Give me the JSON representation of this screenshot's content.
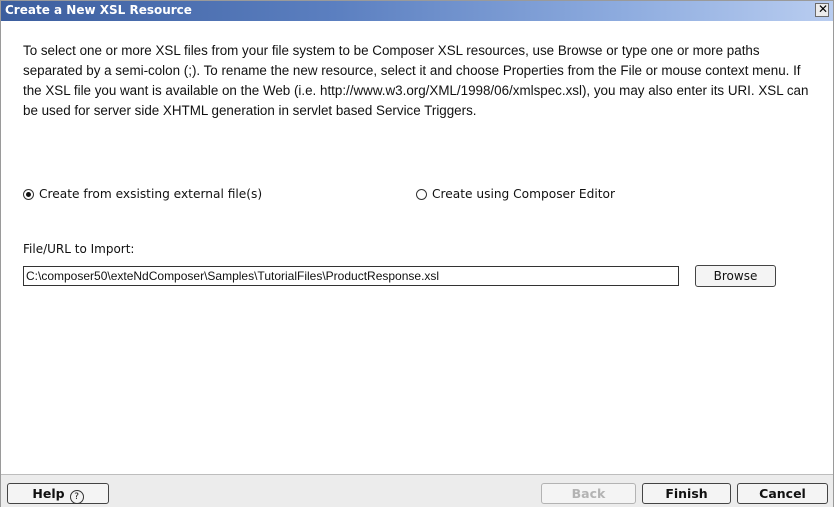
{
  "dialog": {
    "title": "Create a New XSL Resource",
    "close_symbol": "✕"
  },
  "description": "To select one or more XSL files from your file system to be Composer XSL  resources, use Browse or type one or more paths separated by a semi-colon (;). To rename the new resource, select it and choose Properties from the File or mouse context menu. If the XSL file you want is available on the Web (i.e. http://www.w3.org/XML/1998/06/xmlspec.xsl), you may also enter its URI. XSL can be used for server side XHTML generation in servlet based Service Triggers.",
  "options": {
    "existing_file_label": "Create from exsisting external file(s)",
    "existing_file_selected": true,
    "editor_label": "Create using Composer Editor",
    "editor_selected": false
  },
  "import": {
    "label": "File/URL to Import:",
    "value": "C:\\composer50\\exteNdComposer\\Samples\\TutorialFiles\\ProductResponse.xsl",
    "browse_label": "Browse"
  },
  "footer": {
    "help_label": "Help",
    "help_icon": "?",
    "back_label": "Back",
    "finish_label": "Finish",
    "cancel_label": "Cancel"
  }
}
